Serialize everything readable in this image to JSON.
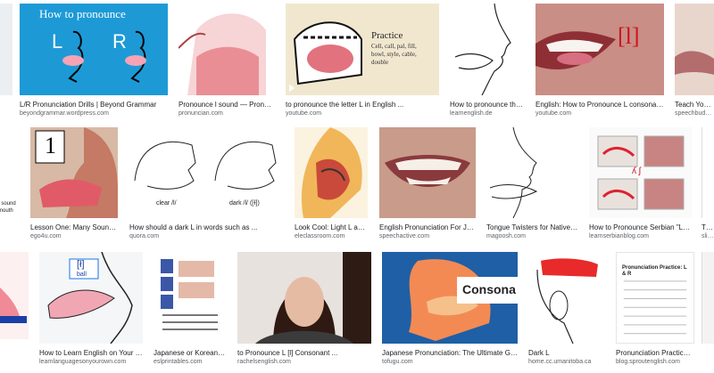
{
  "results": [
    {
      "title": "",
      "source": "",
      "overlay": ""
    },
    {
      "title": "L/R Pronunciation Drills | Beyond Grammar",
      "source": "beyondgrammar.wordpress.com",
      "overlay": "How to pronounce"
    },
    {
      "title": "Pronounce l sound — Pronunciation",
      "source": "pronuncian.com",
      "overlay": ""
    },
    {
      "title": "to pronounce the letter L in English ...",
      "source": "youtube.com",
      "overlay": "Practice"
    },
    {
      "title": "How to pronounce the L ...",
      "source": "learnenglish.de",
      "overlay": ""
    },
    {
      "title": "English: How to Pronounce L consonant ...",
      "source": "youtube.com",
      "overlay": "[l]"
    },
    {
      "title": "Teach Your Child ...",
      "source": "speechbuddy.com",
      "overlay": ""
    },
    {
      "title": "",
      "source": "",
      "overlay": ""
    },
    {
      "title": "Lesson One: Many Sounds I...",
      "source": "ego4u.com",
      "overlay": "1"
    },
    {
      "title": "How should a dark L in words such as ...",
      "source": "quora.com",
      "overlay": ""
    },
    {
      "title": "Look Cool: Light L and ...",
      "source": "eleclassroom.com",
      "overlay": ""
    },
    {
      "title": "English Pronunciation For Jap...",
      "source": "speechactive.com",
      "overlay": ""
    },
    {
      "title": "Tongue Twisters for Native C...",
      "source": "magoosh.com",
      "overlay": ""
    },
    {
      "title": "How to Pronounce Serbian \"LJ\" ...",
      "source": "learnserbianblog.com",
      "overlay": ""
    },
    {
      "title": "Th...",
      "source": "slide...",
      "overlay": ""
    },
    {
      "title": "",
      "source": "",
      "overlay": ""
    },
    {
      "title": "How to Learn English on Your Ow...",
      "source": "learnlanguagesonyourown.com",
      "overlay": "[ł]"
    },
    {
      "title": "Japanese or Korean - E...",
      "source": "eslprintables.com",
      "overlay": ""
    },
    {
      "title": "to Pronounce L [l] Consonant ...",
      "source": "rachelsenglish.com",
      "overlay": ""
    },
    {
      "title": "Japanese Pronunciation: The Ultimate Guide",
      "source": "tofugu.com",
      "overlay": "Consona"
    },
    {
      "title": "Dark L",
      "source": "home.cc.umanitoba.ca",
      "overlay": ""
    },
    {
      "title": "Pronunciation Practice:...",
      "source": "blog.sproutenglish.com",
      "overlay": "Pronunciation Practice: L & R"
    },
    {
      "title": "",
      "source": "",
      "overlay": ""
    }
  ],
  "overlays": {
    "beyond_L": "L",
    "beyond_R": "R",
    "practice_words": "Cell, call, pal, fill, bowl, style, cable, double",
    "clear_label": "clear /l/",
    "dark_label": "dark /l/ ([ɫ])",
    "serbian_glyph": "ʎ ʃ",
    "wall_label": "ball",
    "side_cut": "/ sound mouth"
  },
  "colors": {
    "title": "#202124",
    "source": "#5f6368",
    "accent": "#1a73e8"
  }
}
